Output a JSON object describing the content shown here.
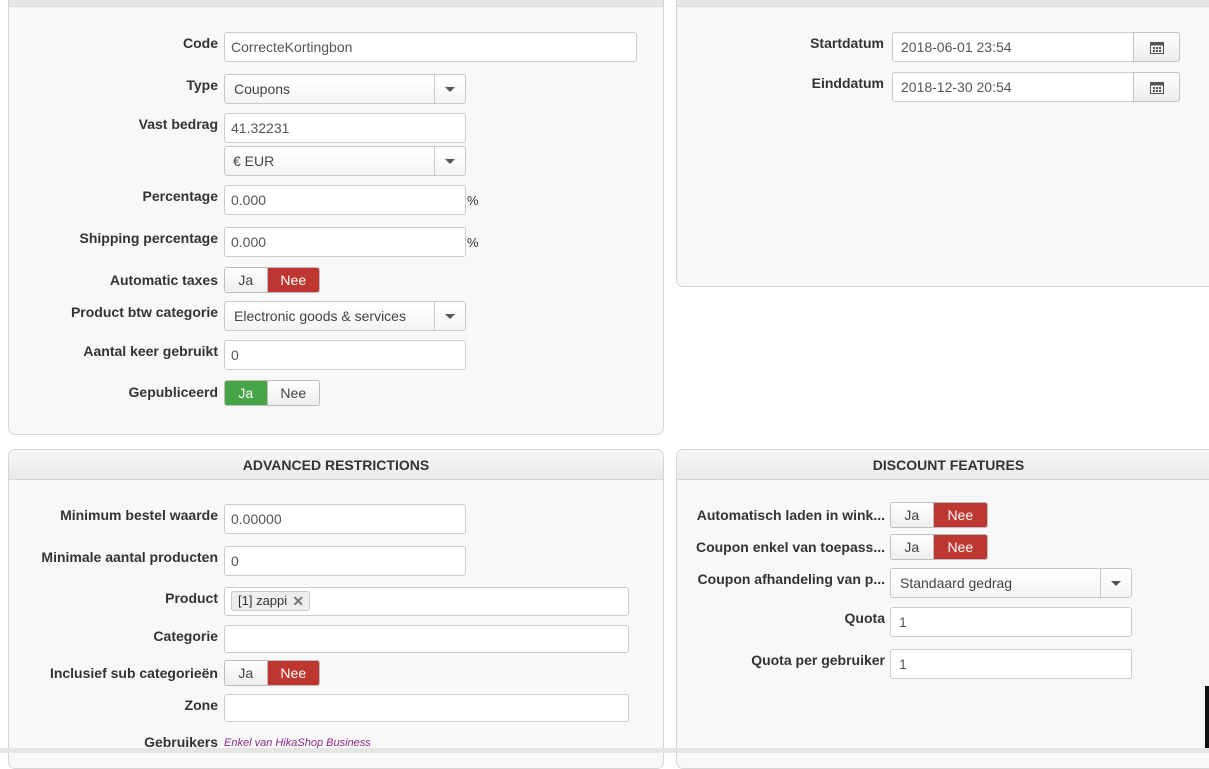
{
  "general": {
    "code": {
      "label": "Code",
      "value": "CorrecteKortingbon"
    },
    "type": {
      "label": "Type",
      "value": "Coupons"
    },
    "fixed_amount": {
      "label": "Vast bedrag",
      "value": "41.32231",
      "currency": "€ EUR"
    },
    "percentage": {
      "label": "Percentage",
      "value": "0.000",
      "unit": "%"
    },
    "shipping_percentage": {
      "label": "Shipping percentage",
      "value": "0.000",
      "unit": "%"
    },
    "automatic_taxes": {
      "label": "Automatic taxes",
      "yes": "Ja",
      "no": "Nee",
      "selected": "Nee"
    },
    "product_tax_category": {
      "label": "Product btw categorie",
      "value": "Electronic goods & services"
    },
    "times_used": {
      "label": "Aantal keer gebruikt",
      "value": "0"
    },
    "published": {
      "label": "Gepubliceerd",
      "yes": "Ja",
      "no": "Nee",
      "selected": "Ja"
    }
  },
  "dates": {
    "start": {
      "label": "Startdatum",
      "value": "2018-06-01 23:54"
    },
    "end": {
      "label": "Einddatum",
      "value": "2018-12-30 20:54"
    }
  },
  "advanced": {
    "title": "ADVANCED RESTRICTIONS",
    "min_order_value": {
      "label": "Minimum bestel waarde",
      "value": "0.00000"
    },
    "min_products": {
      "label": "Minimale aantal producten",
      "value": "0"
    },
    "product": {
      "label": "Product",
      "tag": "[1] zappi",
      "remove": "✕"
    },
    "category": {
      "label": "Categorie",
      "value": ""
    },
    "include_subcategories": {
      "label": "Inclusief sub categorieën",
      "yes": "Ja",
      "no": "Nee",
      "selected": "Nee"
    },
    "zone": {
      "label": "Zone",
      "value": ""
    },
    "users": {
      "label": "Gebruikers",
      "note": "Enkel van HikaShop Business"
    }
  },
  "discount_features": {
    "title": "DISCOUNT FEATURES",
    "auto_load_cart": {
      "label": "Automatisch laden in wink...",
      "yes": "Ja",
      "no": "Nee",
      "selected": "Nee"
    },
    "coupon_only_apply": {
      "label": "Coupon enkel van toepass...",
      "yes": "Ja",
      "no": "Nee",
      "selected": "Nee"
    },
    "coupon_handling": {
      "label": "Coupon afhandeling van p...",
      "value": "Standaard gedrag"
    },
    "quota": {
      "label": "Quota",
      "value": "1"
    },
    "quota_per_user": {
      "label": "Quota per gebruiker",
      "value": "1"
    }
  },
  "colors": {
    "no_active": "#bd362f",
    "yes_active": "#46a546",
    "note": "#8b2a8b"
  },
  "icons": {
    "calendar": "calendar-icon",
    "dropdown": "chevron-down-icon",
    "remove": "close-icon"
  }
}
